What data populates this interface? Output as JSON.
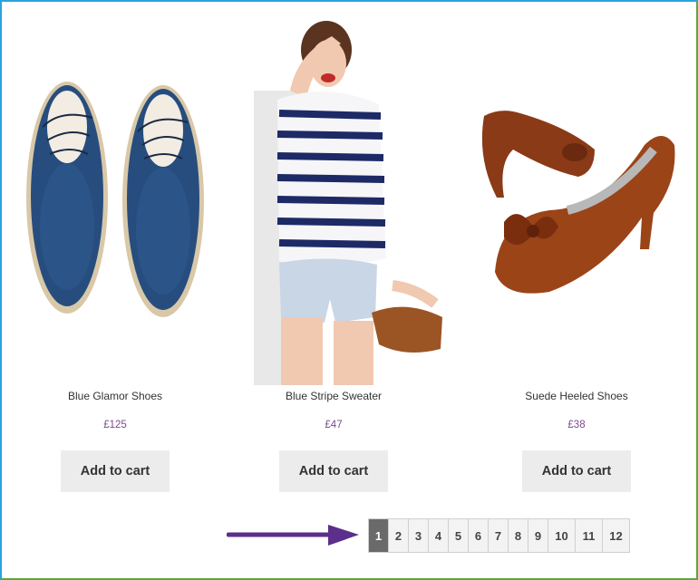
{
  "products": [
    {
      "name": "Blue Glamor Shoes",
      "price": "£125",
      "button": "Add to cart"
    },
    {
      "name": "Blue Stripe Sweater",
      "price": "£47",
      "button": "Add to cart"
    },
    {
      "name": "Suede Heeled Shoes",
      "price": "£38",
      "button": "Add to cart"
    }
  ],
  "pagination": {
    "pages": [
      "1",
      "2",
      "3",
      "4",
      "5",
      "6",
      "7",
      "8",
      "9",
      "10",
      "11",
      "12"
    ],
    "current": "1"
  },
  "colors": {
    "price": "#7b4a8c",
    "arrow": "#5c2f8c",
    "current_page": "#6a6a6a",
    "frame": "#2aa3dc"
  },
  "icons": {
    "arrow": "right-arrow-icon"
  }
}
